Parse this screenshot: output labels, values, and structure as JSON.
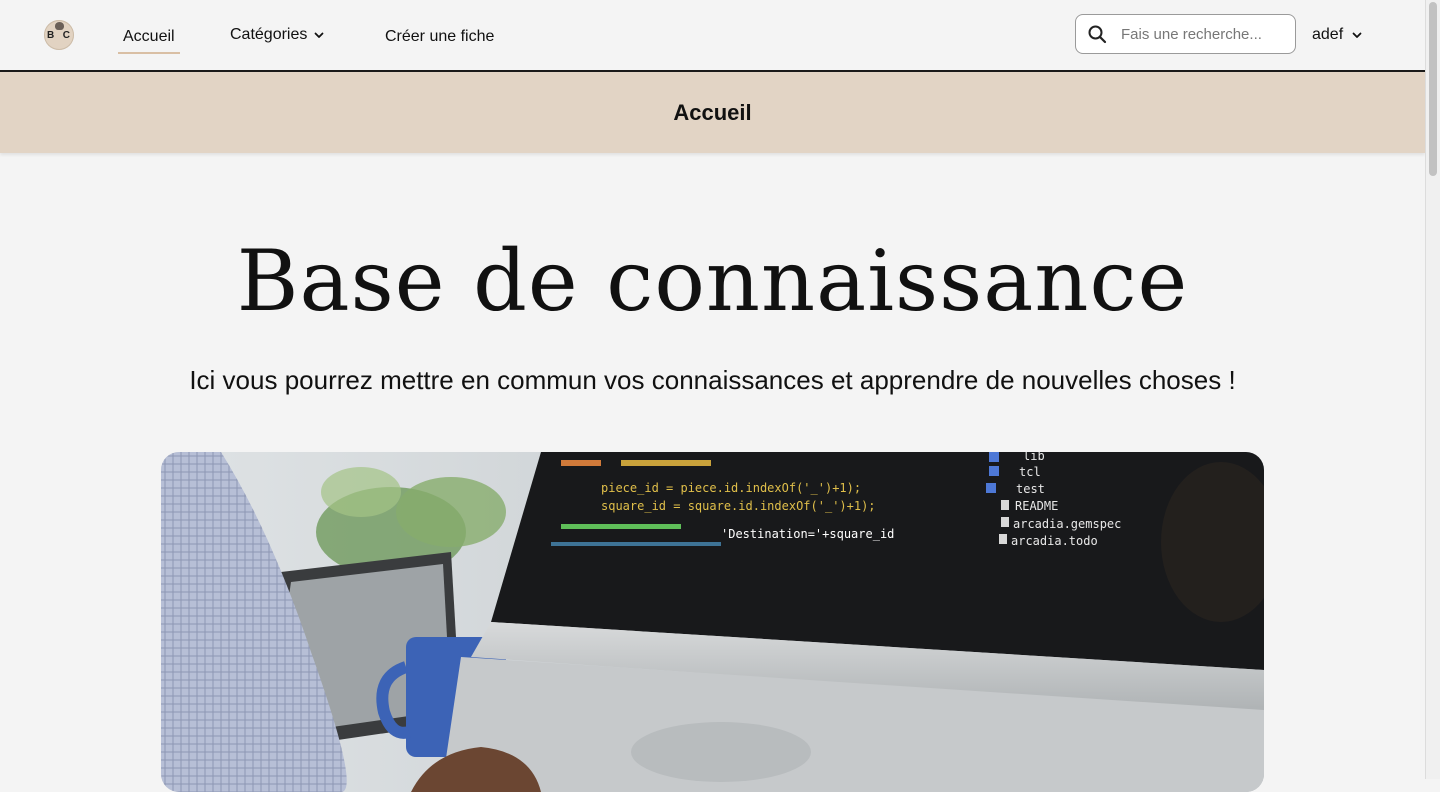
{
  "nav": {
    "logo_letters": [
      "B",
      "C"
    ],
    "links": [
      {
        "label": "Accueil",
        "active": true
      },
      {
        "label": "Catégories",
        "dropdown": true
      },
      {
        "label": "Créer une fiche"
      }
    ],
    "search": {
      "placeholder": "Fais une recherche...",
      "value": ""
    },
    "user": {
      "label": "adef"
    }
  },
  "banner": {
    "title": "Accueil"
  },
  "hero": {
    "title": "Base de connaissance",
    "subtitle": "Ici vous pourrez mettre en commun vos connaissances et apprendre de nouvelles choses !",
    "image_code_lines": [
      "piece_id = piece.id.indexOf('_')+1);",
      "square_id = square.id.indexOf('_')+1);",
      "'Destination='+square_id"
    ],
    "image_file_list": [
      "lib",
      "tcl",
      "test",
      "README",
      "arcadia.gemspec",
      "arcadia.todo"
    ]
  },
  "colors": {
    "accent": "#e2d4c5",
    "active_underline": "#d9bfa4",
    "background": "#f4f4f4"
  }
}
